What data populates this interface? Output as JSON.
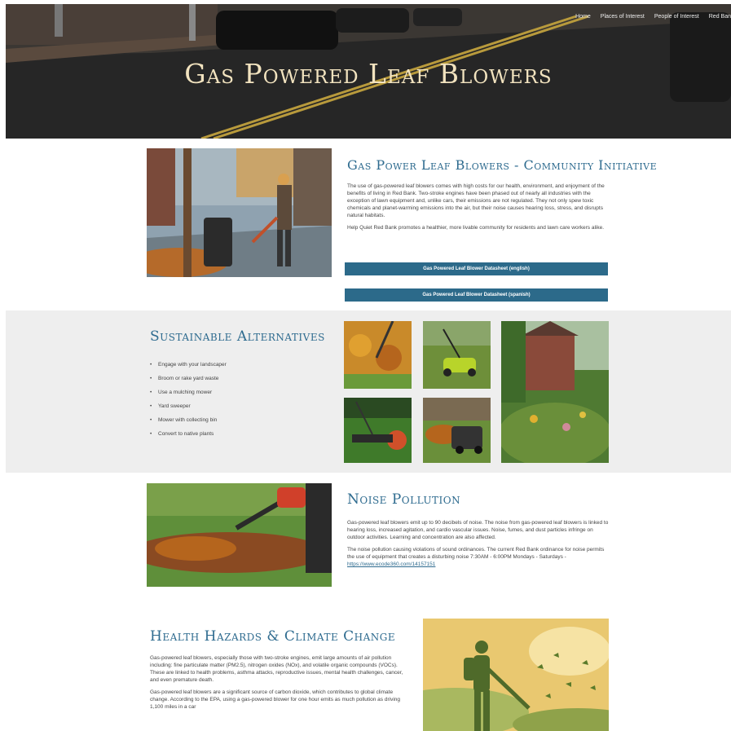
{
  "hero": {
    "title": "Gas Powered Leaf Blowers",
    "nav": [
      "Home",
      "Places of Interest",
      "People of Interest",
      "Red Ban"
    ]
  },
  "community": {
    "title": "Gas Power Leaf Blowers - Community Initiative",
    "paragraph1": "The use of gas-powered leaf blowers comes with high costs for our health, environment, and enjoyment of the benefits of living in Red Bank. Two-stroke engines have been phased out of nearly all industries with the exception of lawn equipment and, unlike cars, their emissions are not regulated. They not only spew toxic chemicals and planet-warming emissions into the air, but their noise causes hearing loss, stress, and disrupts natural habitats.",
    "paragraph2": "Help Quiet Red Bank promotes a healthier, more livable community for residents and lawn care workers alike.",
    "button_english": "Gas Powered Leaf Blower Datasheet (english)",
    "button_spanish": "Gas Powered Leaf Blower Datasheet (spanish)"
  },
  "alternatives": {
    "title": "Sustainable Alternatives",
    "items": [
      "Engage with your landscaper",
      "Broom or rake yard waste",
      "Use a mulching mower",
      "Yard sweeper",
      "Mower with collecting bin",
      "Convert to native plants"
    ]
  },
  "noise": {
    "title": "Noise Pollution",
    "paragraph1": "Gas-powered leaf blowers emit up to 90 decibels of noise. The noise from gas-powered leaf blowers is linked to hearing loss, increased agitation, and cardio vascular issues. Noise, fumes, and dust particles infringe on outdoor activities. Learning and concentration are also affected.",
    "paragraph2": "The noise pollution causing violations of sound ordinances. The current Red Bank ordinance for noise permits the use of equipment that creates a disturbing noise 7:30AM - 6:00PM Mondays - Saturdays -",
    "link": "https://www.ecode360.com/14157151"
  },
  "health": {
    "title": "Health Hazards & Climate Change",
    "paragraph1": "Gas-powered leaf blowers, especially those with two-stroke engines, emit large amounts of air pollution including: fine particulate matter (PM2.5), nitrogen oxides (NOx), and volatile organic compounds (VOCs). These are linked to health problems, asthma attacks, reproductive issues, mental health challenges, cancer, and even premature death.",
    "paragraph2": "Gas-powered leaf blowers are a significant source of carbon dioxide, which contributes to global climate change. According to the EPA, using a gas-powered blower for one hour emits as much pollution as driving 1,100 miles in a car"
  },
  "colors": {
    "accent": "#2e6b8f",
    "button": "#2c6a8a",
    "band": "#eeeeee",
    "hero_title": "#f2e3bf"
  }
}
